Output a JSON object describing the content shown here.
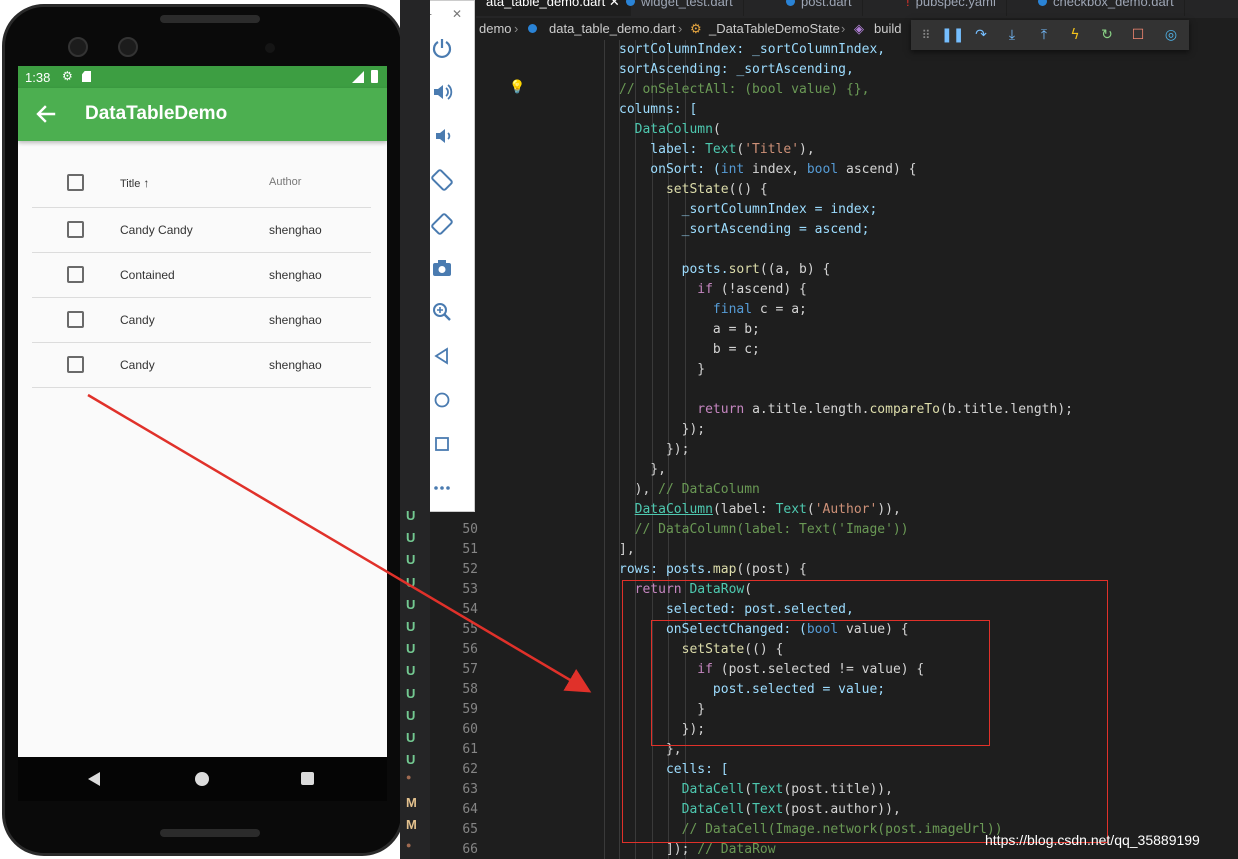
{
  "emulator": {
    "status_time": "1:38",
    "app_title": "DataTableDemo",
    "table": {
      "columns": [
        "Title",
        "Author"
      ],
      "sort_indicator": "↑",
      "rows": [
        {
          "title": "Candy Candy",
          "author": "shenghao",
          "selected": false
        },
        {
          "title": "Contained",
          "author": "shenghao",
          "selected": false
        },
        {
          "title": "Candy",
          "author": "shenghao",
          "selected": false
        },
        {
          "title": "Candy",
          "author": "shenghao",
          "selected": false
        }
      ]
    },
    "toolbar_buttons": [
      "power-icon",
      "volume-up-icon",
      "volume-down-icon",
      "rotate-left-icon",
      "rotate-right-icon",
      "camera-icon",
      "zoom-icon",
      "back-icon",
      "home-icon",
      "overview-icon",
      "more-icon"
    ],
    "window_controls": {
      "minimize": "–",
      "close": "✕"
    }
  },
  "ide": {
    "tabs": [
      {
        "label": "ata_table_demo.dart",
        "active": true
      },
      {
        "label": "widget_test.dart",
        "active": false
      },
      {
        "label": "post.dart",
        "active": false
      },
      {
        "label": "pubspec.yaml",
        "active": false
      },
      {
        "label": "checkbox_demo.dart",
        "active": false
      }
    ],
    "breadcrumb": [
      "demo",
      "data_table_demo.dart",
      "_DataTableDemoState",
      "build"
    ],
    "debug_buttons": [
      "grip-icon",
      "pause-icon",
      "step-over-icon",
      "step-into-icon",
      "step-out-icon",
      "hot-reload-icon",
      "restart-icon",
      "stop-icon",
      "devtools-icon"
    ],
    "line_numbers": [
      "50",
      "51",
      "52",
      "53",
      "54",
      "55",
      "56",
      "57",
      "58",
      "59",
      "60",
      "61",
      "62",
      "63",
      "64",
      "65",
      "66"
    ],
    "scm_markers": [
      "U",
      "U",
      "U",
      "U",
      "U",
      "U",
      "U",
      "U",
      "U",
      "U",
      "U",
      "U",
      "●",
      "M",
      "M",
      "●"
    ],
    "watermark": "https://blog.csdn.net/qq_35889199"
  },
  "colors": {
    "appbar": "#4caf50",
    "statusbar": "#3d9e42",
    "annotation": "#e0312a",
    "editor_bg": "#1e1e1e"
  }
}
